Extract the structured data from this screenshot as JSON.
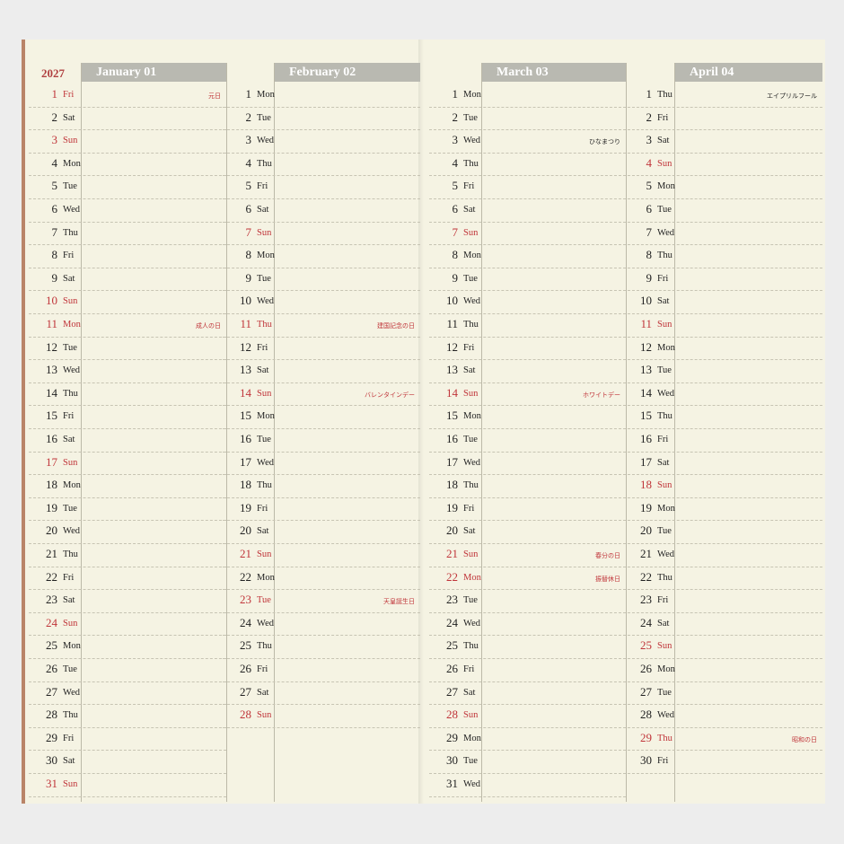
{
  "year": "2027",
  "colors": {
    "accent_red": "#c0353a",
    "header_gray": "#b9b9b1",
    "paper": "#f5f3e3"
  },
  "months": [
    {
      "title": "January 01",
      "days": [
        {
          "d": "1",
          "w": "Fri",
          "red": true,
          "note": "元日"
        },
        {
          "d": "2",
          "w": "Sat"
        },
        {
          "d": "3",
          "w": "Sun",
          "red": true
        },
        {
          "d": "4",
          "w": "Mon"
        },
        {
          "d": "5",
          "w": "Tue"
        },
        {
          "d": "6",
          "w": "Wed"
        },
        {
          "d": "7",
          "w": "Thu"
        },
        {
          "d": "8",
          "w": "Fri"
        },
        {
          "d": "9",
          "w": "Sat"
        },
        {
          "d": "10",
          "w": "Sun",
          "red": true
        },
        {
          "d": "11",
          "w": "Mon",
          "red": true,
          "note": "成人の日"
        },
        {
          "d": "12",
          "w": "Tue"
        },
        {
          "d": "13",
          "w": "Wed"
        },
        {
          "d": "14",
          "w": "Thu"
        },
        {
          "d": "15",
          "w": "Fri"
        },
        {
          "d": "16",
          "w": "Sat"
        },
        {
          "d": "17",
          "w": "Sun",
          "red": true
        },
        {
          "d": "18",
          "w": "Mon"
        },
        {
          "d": "19",
          "w": "Tue"
        },
        {
          "d": "20",
          "w": "Wed"
        },
        {
          "d": "21",
          "w": "Thu"
        },
        {
          "d": "22",
          "w": "Fri"
        },
        {
          "d": "23",
          "w": "Sat"
        },
        {
          "d": "24",
          "w": "Sun",
          "red": true
        },
        {
          "d": "25",
          "w": "Mon"
        },
        {
          "d": "26",
          "w": "Tue"
        },
        {
          "d": "27",
          "w": "Wed"
        },
        {
          "d": "28",
          "w": "Thu"
        },
        {
          "d": "29",
          "w": "Fri"
        },
        {
          "d": "30",
          "w": "Sat"
        },
        {
          "d": "31",
          "w": "Sun",
          "red": true
        }
      ]
    },
    {
      "title": "February 02",
      "days": [
        {
          "d": "1",
          "w": "Mon"
        },
        {
          "d": "2",
          "w": "Tue"
        },
        {
          "d": "3",
          "w": "Wed"
        },
        {
          "d": "4",
          "w": "Thu"
        },
        {
          "d": "5",
          "w": "Fri"
        },
        {
          "d": "6",
          "w": "Sat"
        },
        {
          "d": "7",
          "w": "Sun",
          "red": true
        },
        {
          "d": "8",
          "w": "Mon"
        },
        {
          "d": "9",
          "w": "Tue"
        },
        {
          "d": "10",
          "w": "Wed"
        },
        {
          "d": "11",
          "w": "Thu",
          "red": true,
          "note": "建国記念の日"
        },
        {
          "d": "12",
          "w": "Fri"
        },
        {
          "d": "13",
          "w": "Sat"
        },
        {
          "d": "14",
          "w": "Sun",
          "red": true,
          "note": "バレンタインデー"
        },
        {
          "d": "15",
          "w": "Mon"
        },
        {
          "d": "16",
          "w": "Tue"
        },
        {
          "d": "17",
          "w": "Wed"
        },
        {
          "d": "18",
          "w": "Thu"
        },
        {
          "d": "19",
          "w": "Fri"
        },
        {
          "d": "20",
          "w": "Sat"
        },
        {
          "d": "21",
          "w": "Sun",
          "red": true
        },
        {
          "d": "22",
          "w": "Mon"
        },
        {
          "d": "23",
          "w": "Tue",
          "red": true,
          "note": "天皇誕生日"
        },
        {
          "d": "24",
          "w": "Wed"
        },
        {
          "d": "25",
          "w": "Thu"
        },
        {
          "d": "26",
          "w": "Fri"
        },
        {
          "d": "27",
          "w": "Sat"
        },
        {
          "d": "28",
          "w": "Sun",
          "red": true
        }
      ]
    },
    {
      "title": "March 03",
      "days": [
        {
          "d": "1",
          "w": "Mon"
        },
        {
          "d": "2",
          "w": "Tue"
        },
        {
          "d": "3",
          "w": "Wed",
          "note": "ひなまつり",
          "black": true
        },
        {
          "d": "4",
          "w": "Thu"
        },
        {
          "d": "5",
          "w": "Fri"
        },
        {
          "d": "6",
          "w": "Sat"
        },
        {
          "d": "7",
          "w": "Sun",
          "red": true
        },
        {
          "d": "8",
          "w": "Mon"
        },
        {
          "d": "9",
          "w": "Tue"
        },
        {
          "d": "10",
          "w": "Wed"
        },
        {
          "d": "11",
          "w": "Thu"
        },
        {
          "d": "12",
          "w": "Fri"
        },
        {
          "d": "13",
          "w": "Sat"
        },
        {
          "d": "14",
          "w": "Sun",
          "red": true,
          "note": "ホワイトデー"
        },
        {
          "d": "15",
          "w": "Mon"
        },
        {
          "d": "16",
          "w": "Tue"
        },
        {
          "d": "17",
          "w": "Wed"
        },
        {
          "d": "18",
          "w": "Thu"
        },
        {
          "d": "19",
          "w": "Fri"
        },
        {
          "d": "20",
          "w": "Sat"
        },
        {
          "d": "21",
          "w": "Sun",
          "red": true,
          "note": "春分の日"
        },
        {
          "d": "22",
          "w": "Mon",
          "red": true,
          "note": "振替休日"
        },
        {
          "d": "23",
          "w": "Tue"
        },
        {
          "d": "24",
          "w": "Wed"
        },
        {
          "d": "25",
          "w": "Thu"
        },
        {
          "d": "26",
          "w": "Fri"
        },
        {
          "d": "27",
          "w": "Sat"
        },
        {
          "d": "28",
          "w": "Sun",
          "red": true
        },
        {
          "d": "29",
          "w": "Mon"
        },
        {
          "d": "30",
          "w": "Tue"
        },
        {
          "d": "31",
          "w": "Wed"
        }
      ]
    },
    {
      "title": "April 04",
      "days": [
        {
          "d": "1",
          "w": "Thu",
          "note": "エイプリルフール",
          "black": true
        },
        {
          "d": "2",
          "w": "Fri"
        },
        {
          "d": "3",
          "w": "Sat"
        },
        {
          "d": "4",
          "w": "Sun",
          "red": true
        },
        {
          "d": "5",
          "w": "Mon"
        },
        {
          "d": "6",
          "w": "Tue"
        },
        {
          "d": "7",
          "w": "Wed"
        },
        {
          "d": "8",
          "w": "Thu"
        },
        {
          "d": "9",
          "w": "Fri"
        },
        {
          "d": "10",
          "w": "Sat"
        },
        {
          "d": "11",
          "w": "Sun",
          "red": true
        },
        {
          "d": "12",
          "w": "Mon"
        },
        {
          "d": "13",
          "w": "Tue"
        },
        {
          "d": "14",
          "w": "Wed"
        },
        {
          "d": "15",
          "w": "Thu"
        },
        {
          "d": "16",
          "w": "Fri"
        },
        {
          "d": "17",
          "w": "Sat"
        },
        {
          "d": "18",
          "w": "Sun",
          "red": true
        },
        {
          "d": "19",
          "w": "Mon"
        },
        {
          "d": "20",
          "w": "Tue"
        },
        {
          "d": "21",
          "w": "Wed"
        },
        {
          "d": "22",
          "w": "Thu"
        },
        {
          "d": "23",
          "w": "Fri"
        },
        {
          "d": "24",
          "w": "Sat"
        },
        {
          "d": "25",
          "w": "Sun",
          "red": true
        },
        {
          "d": "26",
          "w": "Mon"
        },
        {
          "d": "27",
          "w": "Tue"
        },
        {
          "d": "28",
          "w": "Wed"
        },
        {
          "d": "29",
          "w": "Thu",
          "red": true,
          "note": "昭和の日"
        },
        {
          "d": "30",
          "w": "Fri"
        }
      ]
    }
  ]
}
